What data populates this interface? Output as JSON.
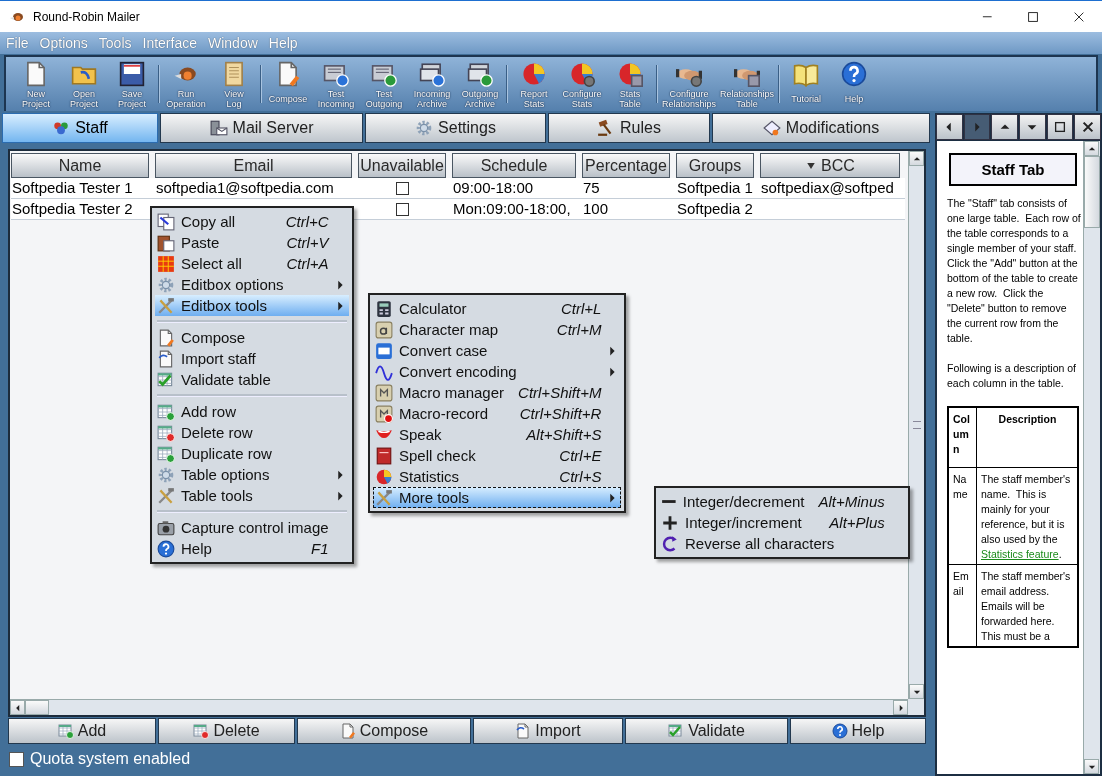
{
  "window": {
    "title": "Round-Robin Mailer"
  },
  "menu_bar": [
    "File",
    "Options",
    "Tools",
    "Interface",
    "Window",
    "Help"
  ],
  "toolbar": [
    [
      {
        "lines": [
          "New",
          "Project"
        ]
      },
      {
        "lines": [
          "Open",
          "Project"
        ]
      },
      {
        "lines": [
          "Save",
          "Project"
        ]
      }
    ],
    [
      {
        "lines": [
          "Run",
          "Operation"
        ]
      },
      {
        "lines": [
          "View",
          "Log"
        ]
      }
    ],
    [
      {
        "lines": [
          "Compose"
        ]
      },
      {
        "lines": [
          "Test",
          "Incoming"
        ]
      },
      {
        "lines": [
          "Test",
          "Outgoing"
        ]
      },
      {
        "lines": [
          "Incoming",
          "Archive"
        ]
      },
      {
        "lines": [
          "Outgoing",
          "Archive"
        ]
      }
    ],
    [
      {
        "lines": [
          "Report",
          "Stats"
        ]
      },
      {
        "lines": [
          "Configure",
          "Stats"
        ]
      },
      {
        "lines": [
          "Stats",
          "Table"
        ]
      }
    ],
    [
      {
        "lines": [
          "Configure",
          "Relationships"
        ]
      },
      {
        "lines": [
          "Relationships",
          "Table"
        ]
      }
    ],
    [
      {
        "lines": [
          "Tutorial"
        ]
      },
      {
        "lines": [
          "Help"
        ]
      }
    ]
  ],
  "tabs": [
    {
      "label": "Staff",
      "selected": true
    },
    {
      "label": "Mail Server",
      "selected": false
    },
    {
      "label": "Settings",
      "selected": false
    },
    {
      "label": "Rules",
      "selected": false
    },
    {
      "label": "Modifications",
      "selected": false
    }
  ],
  "staff_table": {
    "columns": [
      "Name",
      "Email",
      "Unavailable",
      "Schedule",
      "Percentage",
      "Groups",
      "BCC"
    ],
    "rows": [
      {
        "name": "Softpedia Tester 1",
        "email": "softpedia1@softpedia.com",
        "unavailable": false,
        "schedule": "09:00-18:00",
        "percentage": "75",
        "groups": "Softpedia 1",
        "bcc": "softpediax@softped"
      },
      {
        "name": "Softpedia Tester 2",
        "unavailable": false,
        "schedule": "Mon:09:00-18:00,",
        "percentage": "100",
        "groups": "Softpedia 2"
      }
    ]
  },
  "bottom_buttons": [
    "Add",
    "Delete",
    "Compose",
    "Import",
    "Validate",
    "Help"
  ],
  "quota": {
    "label": "Quota system enabled",
    "checked": false
  },
  "context_menu": {
    "groups": [
      [
        {
          "label": "Copy all",
          "shortcut": "Ctrl+C",
          "submenu": false,
          "selected": false
        },
        {
          "label": "Paste",
          "shortcut": "Ctrl+V",
          "submenu": false,
          "selected": false
        },
        {
          "label": "Select all",
          "shortcut": "Ctrl+A",
          "submenu": false,
          "selected": false
        },
        {
          "label": "Editbox options",
          "submenu": true,
          "selected": false
        },
        {
          "label": "Editbox tools",
          "submenu": true,
          "selected": true
        }
      ],
      [
        {
          "label": "Compose",
          "submenu": false,
          "selected": false
        },
        {
          "label": "Import staff",
          "submenu": false,
          "selected": false
        },
        {
          "label": "Validate table",
          "submenu": false,
          "selected": false
        }
      ],
      [
        {
          "label": "Add row",
          "submenu": false,
          "selected": false
        },
        {
          "label": "Delete row",
          "submenu": false,
          "selected": false
        },
        {
          "label": "Duplicate row",
          "submenu": false,
          "selected": false
        },
        {
          "label": "Table options",
          "submenu": true,
          "selected": false
        },
        {
          "label": "Table tools",
          "submenu": true,
          "selected": false
        }
      ],
      [
        {
          "label": "Capture control image",
          "submenu": false,
          "selected": false
        },
        {
          "label": "Help",
          "shortcut": "F1",
          "submenu": false,
          "selected": false
        }
      ]
    ]
  },
  "editbox_tools_menu": {
    "groups": [
      [
        {
          "label": "Calculator",
          "shortcut": "Ctrl+L",
          "submenu": false,
          "selected": false
        },
        {
          "label": "Character map",
          "shortcut": "Ctrl+M",
          "submenu": false,
          "selected": false
        },
        {
          "label": "Convert case",
          "submenu": true,
          "selected": false
        },
        {
          "label": "Convert encoding",
          "submenu": true,
          "selected": false
        },
        {
          "label": "Macro manager",
          "shortcut": "Ctrl+Shift+M",
          "submenu": false,
          "selected": false
        },
        {
          "label": "Macro-record",
          "shortcut": "Ctrl+Shift+R",
          "submenu": false,
          "selected": false
        },
        {
          "label": "Speak",
          "shortcut": "Alt+Shift+S",
          "submenu": false,
          "selected": false
        },
        {
          "label": "Spell check",
          "shortcut": "Ctrl+E",
          "submenu": false,
          "selected": false
        },
        {
          "label": "Statistics",
          "shortcut": "Ctrl+S",
          "submenu": false,
          "selected": false
        },
        {
          "label": "More tools",
          "submenu": true,
          "selected": true
        }
      ]
    ]
  },
  "more_tools_menu": {
    "groups": [
      [
        {
          "label": "Integer/decrement",
          "shortcut": "Alt+Minus",
          "submenu": false,
          "selected": false
        },
        {
          "label": "Integer/increment",
          "shortcut": "Alt+Plus",
          "submenu": false,
          "selected": false
        },
        {
          "label": "Reverse all characters",
          "submenu": false,
          "selected": false
        }
      ]
    ]
  },
  "help_panel": {
    "nav": [
      {
        "disabled": false
      },
      {
        "disabled": true
      },
      {
        "disabled": false
      },
      {
        "disabled": false
      },
      {
        "disabled": false
      },
      {
        "disabled": false
      }
    ],
    "title": "Staff Tab",
    "paragraphs": [
      "The \"Staff\" tab consists of one large table.  Each row of the table corresponds to a single member of your staff.  Click the \"Add\" button at the bottom of the table to create a new row.  Click the \"Delete\" button to remove the current row from the table.",
      "Following is a description of each column in the table."
    ],
    "table": {
      "columns": [
        "Column",
        "Description"
      ],
      "rows": [
        {
          "column": "Name",
          "text": "The staff member's name.  This is mainly for your reference, but it is also used by the ",
          "link": "Statistics feature",
          "after": "."
        },
        {
          "column": "Email",
          "text": "The staff member's email address. Emails will be forwarded here.  This must be a"
        }
      ]
    }
  }
}
